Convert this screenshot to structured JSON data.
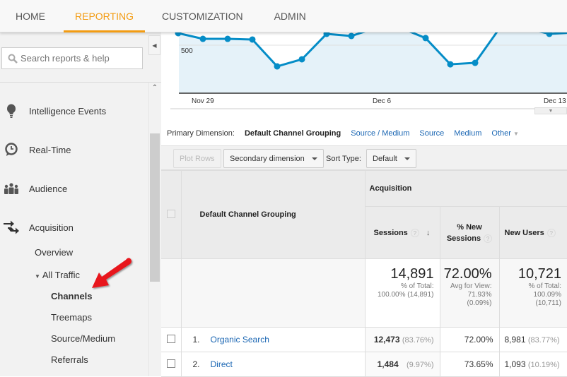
{
  "topnav": {
    "tabs": [
      {
        "label": "HOME",
        "active": false
      },
      {
        "label": "REPORTING",
        "active": true
      },
      {
        "label": "CUSTOMIZATION",
        "active": false
      },
      {
        "label": "ADMIN",
        "active": false
      }
    ],
    "accent_color": "#f39c12"
  },
  "sidebar": {
    "search_placeholder": "Search reports & help",
    "items": [
      {
        "label": "Intelligence Events",
        "icon": "lightbulb-icon"
      },
      {
        "label": "Real-Time",
        "icon": "clock-icon"
      },
      {
        "label": "Audience",
        "icon": "people-icon"
      },
      {
        "label": "Acquisition",
        "icon": "acquisition-arrows-icon"
      }
    ],
    "acquisition_sub": {
      "overview": "Overview",
      "all_traffic": "All Traffic",
      "children": [
        "Channels",
        "Treemaps",
        "Source/Medium",
        "Referrals"
      ],
      "selected": "Channels"
    }
  },
  "chart_data": {
    "type": "area",
    "series": [
      {
        "name": "Sessions",
        "values": [
          625,
          566,
          566,
          559,
          279,
          353,
          618,
          596,
          680,
          680,
          574,
          301,
          316,
          680,
          680,
          618,
          632
        ]
      }
    ],
    "x_tick_labels": [
      "Nov 29",
      "Dec 6",
      "Dec 13"
    ],
    "y_tick_labels": [
      "500"
    ],
    "ylim": [
      0,
      700
    ],
    "line_color": "#058dc7",
    "fill_color": "#e5f2f9"
  },
  "primary_dimension": {
    "label": "Primary Dimension:",
    "selected": "Default Channel Grouping",
    "options": [
      "Source / Medium",
      "Source",
      "Medium",
      "Other"
    ]
  },
  "toolbar": {
    "plot_rows": "Plot Rows",
    "secondary_dimension": "Secondary dimension",
    "sort_type_label": "Sort Type:",
    "sort_type_value": "Default"
  },
  "table": {
    "dimension_header": "Default Channel Grouping",
    "group_header": "Acquisition",
    "columns": [
      "Sessions",
      "% New Sessions",
      "New Users"
    ],
    "totals": {
      "sessions": {
        "value": "14,891",
        "line1": "% of Total:",
        "line2": "100.00% (14,891)"
      },
      "new_sessions": {
        "value": "72.00%",
        "line1": "Avg for View:",
        "line2": "71.93%",
        "line3": "(0.09%)"
      },
      "new_users": {
        "value": "10,721",
        "line1": "% of Total:",
        "line2": "100.09%",
        "line3": "(10,711)"
      }
    },
    "rows": [
      {
        "index": "1.",
        "channel": "Organic Search",
        "sessions": "12,473",
        "sessions_pct": "(83.76%)",
        "new_sessions": "72.00%",
        "new_users": "8,981",
        "new_users_pct": "(83.77%)"
      },
      {
        "index": "2.",
        "channel": "Direct",
        "sessions": "1,484",
        "sessions_pct": "(9.97%)",
        "new_sessions": "73.65%",
        "new_users": "1,093",
        "new_users_pct": "(10.19%)"
      }
    ]
  }
}
